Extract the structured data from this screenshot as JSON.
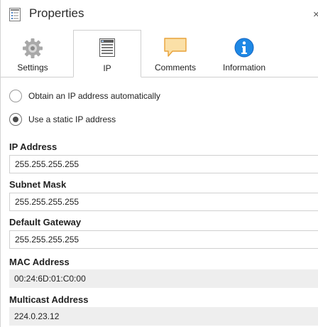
{
  "header": {
    "title": "Properties",
    "close_glyph": "×"
  },
  "tabs": [
    {
      "label": "Settings",
      "icon": "gear-icon",
      "active": false
    },
    {
      "label": "IP",
      "icon": "ip-list-icon",
      "active": true
    },
    {
      "label": "Comments",
      "icon": "comment-icon",
      "active": false
    },
    {
      "label": "Information",
      "icon": "info-icon",
      "active": false
    }
  ],
  "ip_mode": {
    "auto_label": "Obtain an IP address automatically",
    "static_label": "Use a static IP address",
    "selected": "static"
  },
  "fields": {
    "ip_address": {
      "label": "IP Address",
      "value": "255.255.255.255"
    },
    "subnet_mask": {
      "label": "Subnet Mask",
      "value": "255.255.255.255"
    },
    "default_gateway": {
      "label": "Default Gateway",
      "value": "255.255.255.255"
    },
    "mac_address": {
      "label": "MAC Address",
      "value": "00:24:6D:01:C0:00"
    },
    "multicast_address": {
      "label": "Multicast Address",
      "value": "224.0.23.12"
    }
  },
  "colors": {
    "comment_icon_fill": "#fbe0a7",
    "comment_icon_stroke": "#e8a23a",
    "info_icon": "#1e88e5",
    "readonly_bg": "#eeeeee"
  }
}
